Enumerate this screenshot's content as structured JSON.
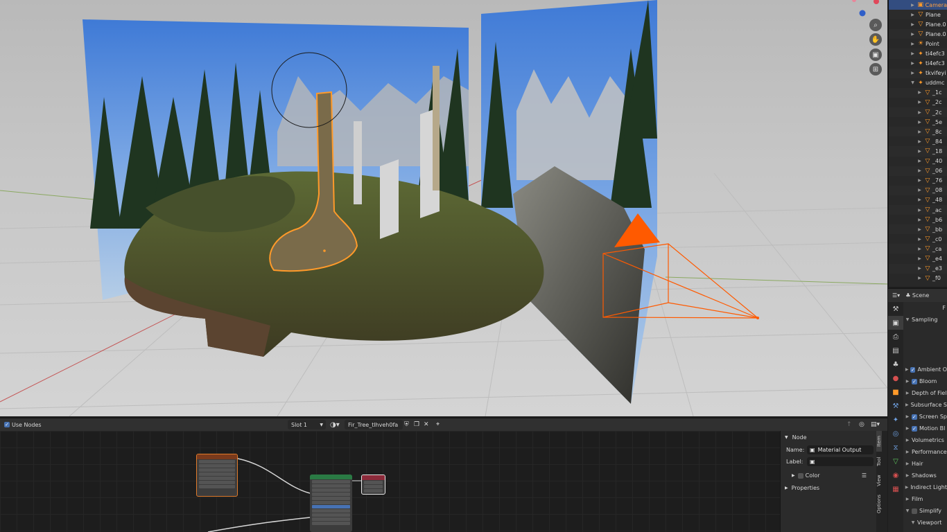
{
  "viewport": {
    "nav_icons": [
      "zoom-icon",
      "hand-pan-icon",
      "camera-view-icon",
      "grid-view-icon"
    ]
  },
  "outliner": {
    "items": [
      {
        "label": "Camera",
        "icon": "camera",
        "selected": true
      },
      {
        "label": "Plane",
        "icon": "mesh"
      },
      {
        "label": "Plane.0",
        "icon": "mesh"
      },
      {
        "label": "Plane.0",
        "icon": "mesh"
      },
      {
        "label": "Point",
        "icon": "light"
      },
      {
        "label": "ti4efc3",
        "icon": "armature"
      },
      {
        "label": "ti4efc3",
        "icon": "armature"
      },
      {
        "label": "tkvifeyi",
        "icon": "armature"
      },
      {
        "label": "uddmc",
        "icon": "armature"
      },
      {
        "label": "_1c",
        "icon": "mesh",
        "child": true
      },
      {
        "label": "_2c",
        "icon": "mesh",
        "child": true
      },
      {
        "label": "_2c",
        "icon": "mesh",
        "child": true
      },
      {
        "label": "_5e",
        "icon": "mesh",
        "child": true
      },
      {
        "label": "_8c",
        "icon": "mesh",
        "child": true
      },
      {
        "label": "_84",
        "icon": "mesh",
        "child": true
      },
      {
        "label": "_18",
        "icon": "mesh",
        "child": true
      },
      {
        "label": "_40",
        "icon": "mesh",
        "child": true
      },
      {
        "label": "_06",
        "icon": "mesh",
        "child": true
      },
      {
        "label": "_76",
        "icon": "mesh",
        "child": true
      },
      {
        "label": "_08",
        "icon": "mesh",
        "child": true
      },
      {
        "label": "_48",
        "icon": "mesh",
        "child": true
      },
      {
        "label": "_ac",
        "icon": "mesh",
        "child": true
      },
      {
        "label": "_b6",
        "icon": "mesh",
        "child": true
      },
      {
        "label": "_bb",
        "icon": "mesh",
        "child": true
      },
      {
        "label": "_c0",
        "icon": "mesh",
        "child": true
      },
      {
        "label": "_ca",
        "icon": "mesh",
        "child": true
      },
      {
        "label": "_e4",
        "icon": "mesh",
        "child": true
      },
      {
        "label": "_e3",
        "icon": "mesh",
        "child": true
      },
      {
        "label": "_f0",
        "icon": "mesh",
        "child": true
      }
    ]
  },
  "properties": {
    "scene_label": "Scene",
    "render_char": "F",
    "sampling": "Sampling",
    "panels": [
      {
        "label": "Ambient O",
        "check": "on"
      },
      {
        "label": "Bloom",
        "check": "on"
      },
      {
        "label": "Depth of Fiel",
        "check": "none"
      },
      {
        "label": "Subsurface S",
        "check": "none"
      },
      {
        "label": "Screen Sp",
        "check": "on"
      },
      {
        "label": "Motion Bl",
        "check": "on"
      },
      {
        "label": "Volumetrics",
        "check": "none"
      },
      {
        "label": "Performance",
        "check": "none"
      },
      {
        "label": "Hair",
        "check": "none"
      },
      {
        "label": "Shadows",
        "check": "none"
      },
      {
        "label": "Indirect Light",
        "check": "none"
      },
      {
        "label": "Film",
        "check": "none"
      },
      {
        "label": "Simplify",
        "check": "off",
        "open": true
      },
      {
        "label": "Viewport",
        "check": "none",
        "sub": true
      }
    ]
  },
  "node_editor": {
    "use_nodes_label": "Use Nodes",
    "slot": "Slot 1",
    "material_name": "Fir_Tree_tlhveh0fa",
    "side_panel": {
      "section": "Node",
      "name_label": "Name:",
      "name_value": "Material Output",
      "label_label": "Label:",
      "label_value": "",
      "color_label": "Color",
      "properties_label": "Properties"
    },
    "side_tabs": [
      "Item",
      "Tool",
      "View",
      "Options"
    ]
  },
  "colors": {
    "accent": "#4772b3",
    "selection_orange": "#ffa040",
    "camera_orange": "#ff5a00"
  }
}
